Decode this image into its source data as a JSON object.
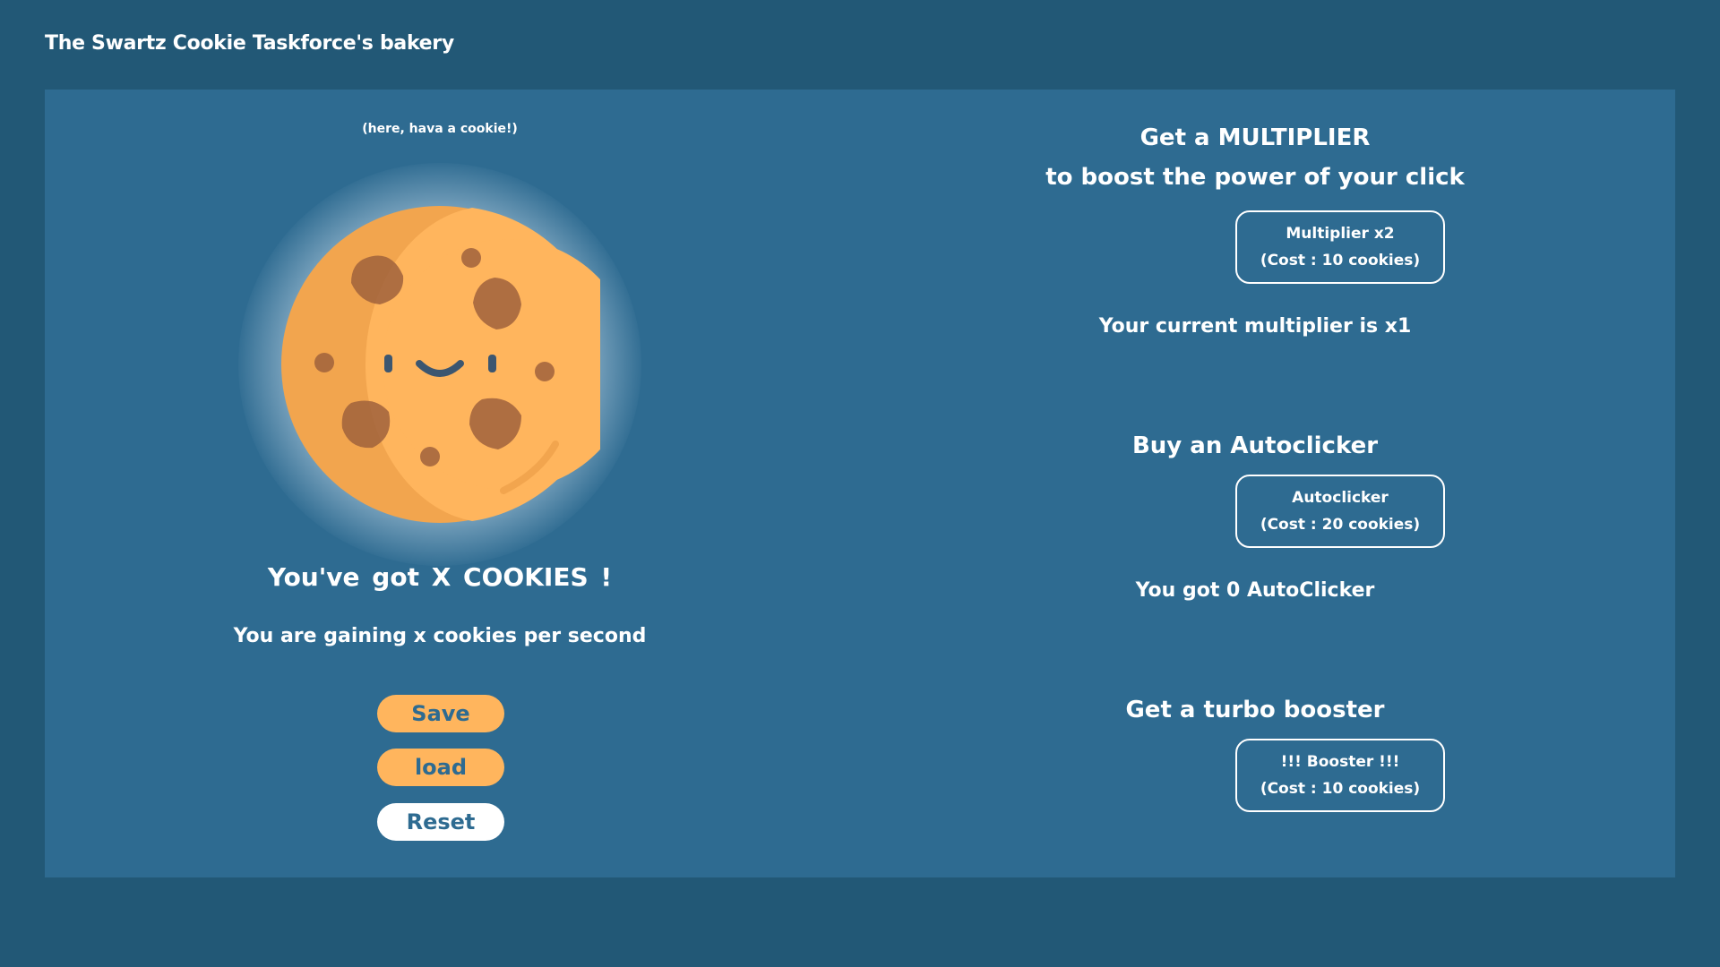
{
  "header": {
    "title": "The Swartz Cookie Taskforce's bakery"
  },
  "cookie": {
    "caption": "(here, hava a cookie!)",
    "count_text": "You've got  X  COOKIES !",
    "rate_text": "You are gaining x cookies per second"
  },
  "actions": {
    "save_label": "Save",
    "load_label": "load",
    "reset_label": "Reset"
  },
  "shop": {
    "multiplier": {
      "heading_line1": "Get a MULTIPLIER",
      "heading_line2": "to boost the power of your click",
      "button_line1": "Multiplier x2",
      "button_line2": "(Cost : 10 cookies)",
      "status": "Your current multiplier is x1"
    },
    "autoclicker": {
      "heading": "Buy an Autoclicker",
      "button_line1": "Autoclicker",
      "button_line2": "(Cost : 20 cookies)",
      "status": "You got 0 AutoClicker"
    },
    "booster": {
      "heading": "Get a turbo booster",
      "button_line1": "!!! Booster !!!",
      "button_line2": "(Cost : 10 cookies)"
    }
  },
  "colors": {
    "page_background": "#225876",
    "panel_background": "#2e6b91",
    "accent_orange": "#ffb55d",
    "cookie_dark": "#f2a54e",
    "chip_brown": "#a0613c",
    "text": "#ffffff"
  }
}
